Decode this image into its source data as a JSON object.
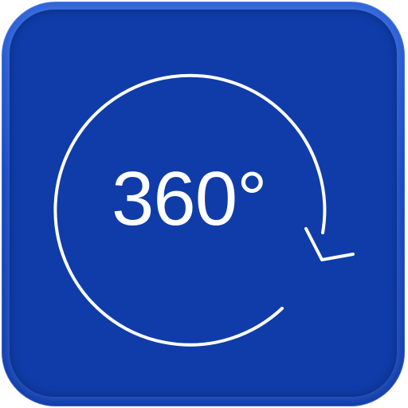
{
  "app_icon": {
    "label": "360°",
    "icon": "rotate-360-icon",
    "colors": {
      "background": "#0f3ca8",
      "accent": "#ffffff"
    }
  }
}
